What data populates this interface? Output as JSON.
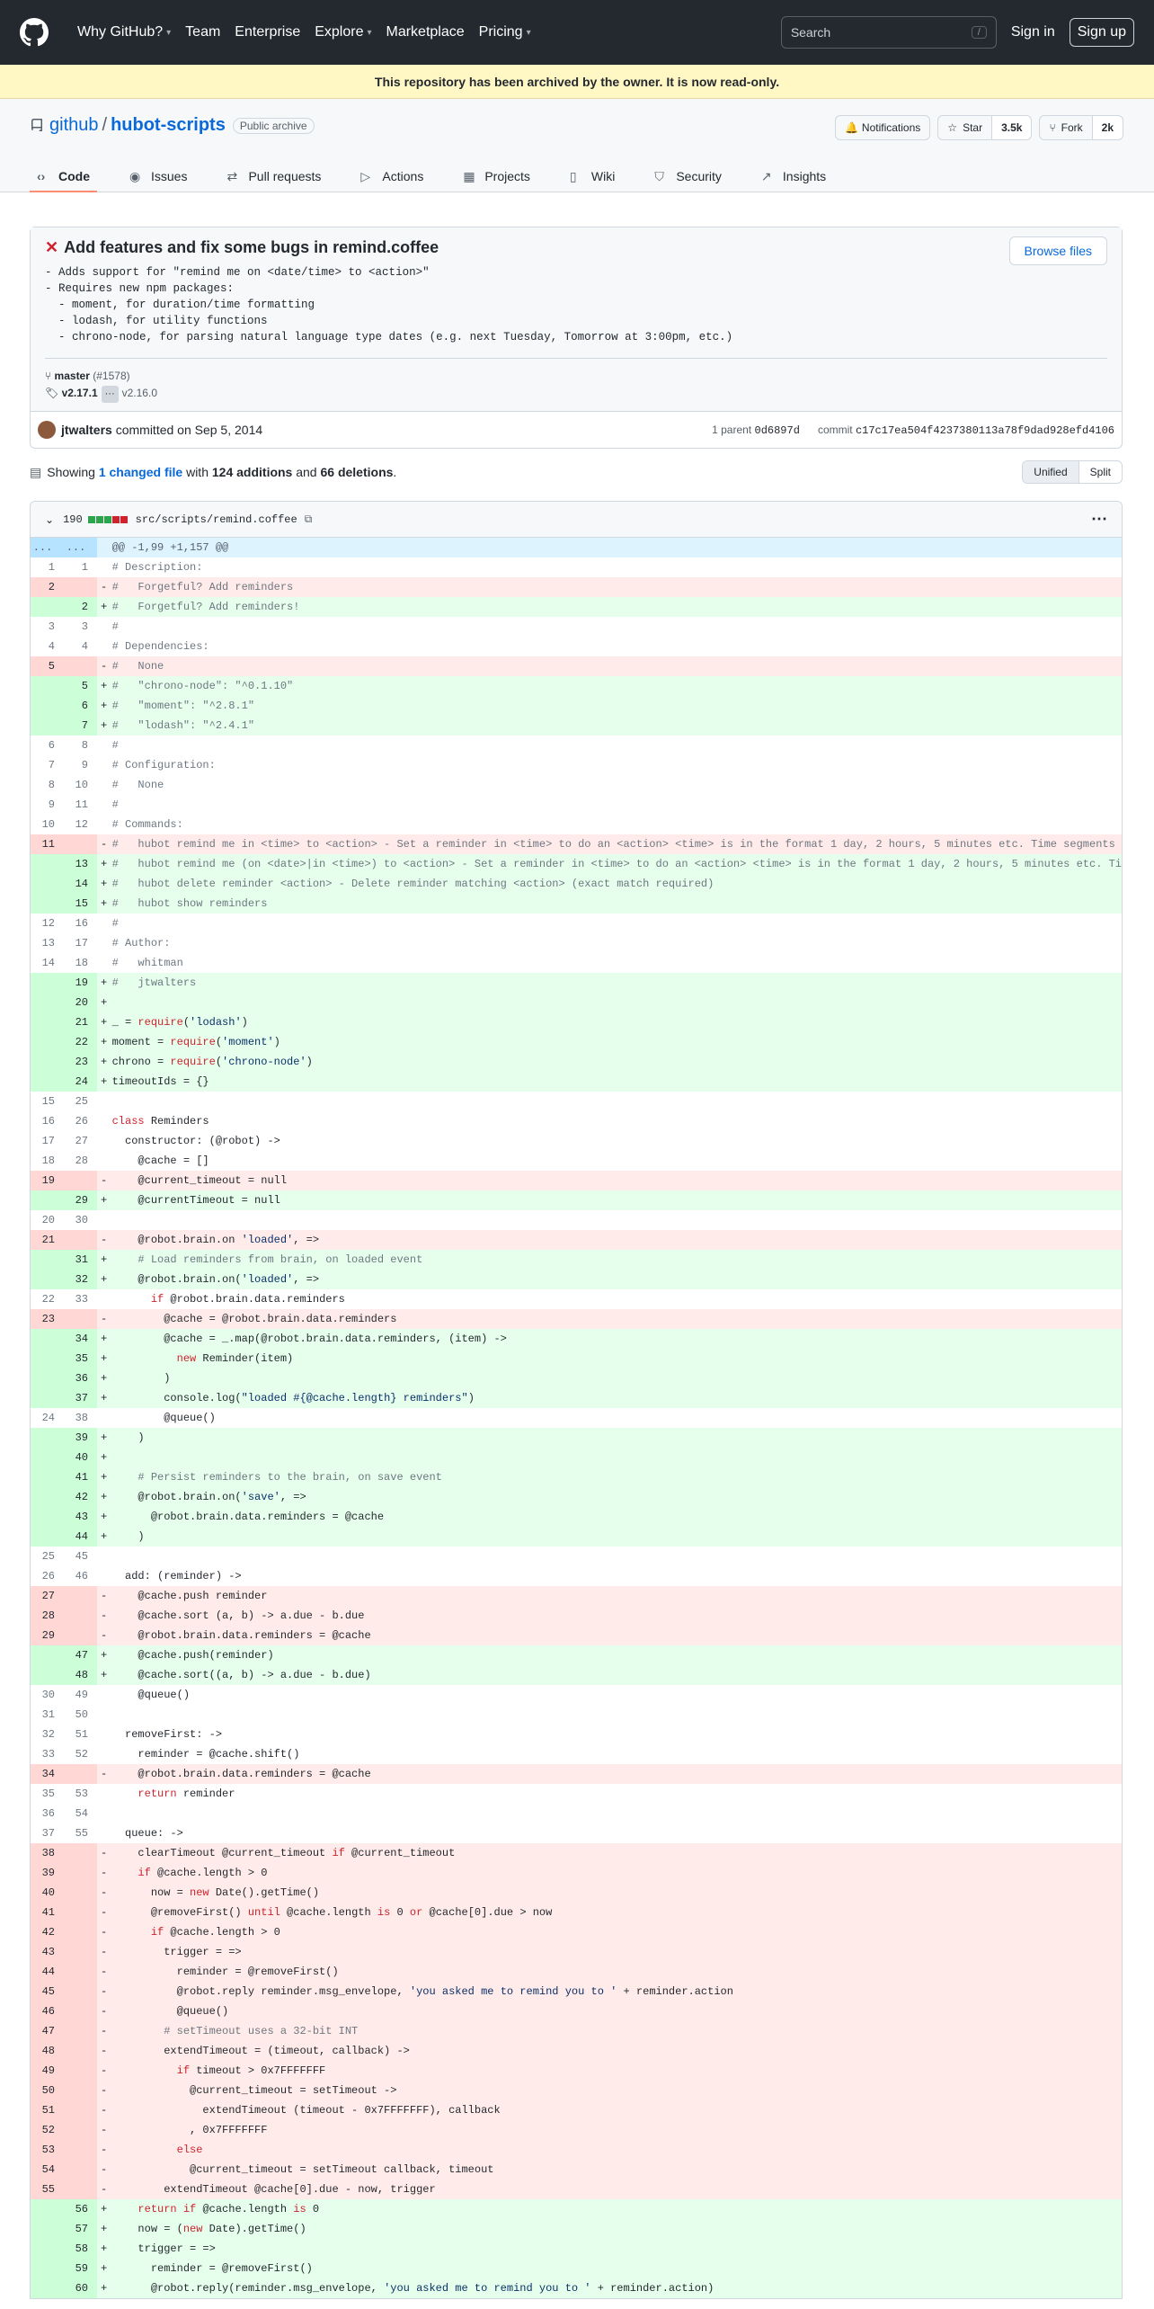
{
  "header": {
    "nav": [
      {
        "label": "Why GitHub?",
        "caret": true
      },
      {
        "label": "Team",
        "caret": false
      },
      {
        "label": "Enterprise",
        "caret": false
      },
      {
        "label": "Explore",
        "caret": true
      },
      {
        "label": "Marketplace",
        "caret": false
      },
      {
        "label": "Pricing",
        "caret": true
      }
    ],
    "search_placeholder": "Search",
    "search_key": "/",
    "signin": "Sign in",
    "signup": "Sign up"
  },
  "banner": "This repository has been archived by the owner. It is now read-only.",
  "repo": {
    "owner": "github",
    "sep": "/",
    "name": "hubot-scripts",
    "label": "Public archive",
    "notifications": "Notifications",
    "star": "Star",
    "star_count": "3.5k",
    "fork": "Fork",
    "fork_count": "2k"
  },
  "tabs": [
    {
      "label": "Code",
      "icon": "code-icon",
      "selected": true
    },
    {
      "label": "Issues",
      "icon": "issue-icon"
    },
    {
      "label": "Pull requests",
      "icon": "pull-request-icon"
    },
    {
      "label": "Actions",
      "icon": "play-icon"
    },
    {
      "label": "Projects",
      "icon": "table-icon"
    },
    {
      "label": "Wiki",
      "icon": "book-icon"
    },
    {
      "label": "Security",
      "icon": "shield-icon"
    },
    {
      "label": "Insights",
      "icon": "graph-icon"
    }
  ],
  "commit": {
    "title": "Add features and fix some bugs in remind.coffee",
    "browse": "Browse files",
    "description": "- Adds support for \"remind me on <date/time> to <action>\"\n- Requires new npm packages:\n  - moment, for duration/time formatting\n  - lodash, for utility functions\n  - chrono-node, for parsing natural language type dates (e.g. next Tuesday, Tomorrow at 3:00pm, etc.)",
    "branch": "master",
    "pr": "(#1578)",
    "tag": "v2.17.1",
    "tag_dots": "···",
    "tag_old": "v2.16.0",
    "author": "jtwalters",
    "committed": "committed on Sep 5, 2014",
    "parent_label": "1 parent",
    "parent": "0d6897d",
    "commit_label": "commit",
    "sha": "c17c17ea504f4237380113a78f9dad928efd4106"
  },
  "summary": {
    "showing": "Showing",
    "changed": "1 changed file",
    "with": "with",
    "additions": "124 additions",
    "and": "and",
    "deletions": "66 deletions",
    "end": ".",
    "unified": "Unified",
    "split": "Split"
  },
  "file": {
    "changes": "190",
    "path": "src/scripts/remind.coffee"
  },
  "diff": [
    {
      "t": "hunk",
      "l": "...",
      "r": "...",
      "c": "@@ -1,99 +1,157 @@"
    },
    {
      "t": "ctx",
      "l": "1",
      "r": "1",
      "c": "# Description:"
    },
    {
      "t": "del",
      "l": "2",
      "r": "",
      "c": "#   Forgetful? Add reminders"
    },
    {
      "t": "add",
      "l": "",
      "r": "2",
      "c": "#   Forgetful? Add reminders!"
    },
    {
      "t": "ctx",
      "l": "3",
      "r": "3",
      "c": "#"
    },
    {
      "t": "ctx",
      "l": "4",
      "r": "4",
      "c": "# Dependencies:"
    },
    {
      "t": "del",
      "l": "5",
      "r": "",
      "c": "#   None"
    },
    {
      "t": "add",
      "l": "",
      "r": "5",
      "c": "#   \"chrono-node\": \"^0.1.10\""
    },
    {
      "t": "add",
      "l": "",
      "r": "6",
      "c": "#   \"moment\": \"^2.8.1\""
    },
    {
      "t": "add",
      "l": "",
      "r": "7",
      "c": "#   \"lodash\": \"^2.4.1\""
    },
    {
      "t": "ctx",
      "l": "6",
      "r": "8",
      "c": "#"
    },
    {
      "t": "ctx",
      "l": "7",
      "r": "9",
      "c": "# Configuration:"
    },
    {
      "t": "ctx",
      "l": "8",
      "r": "10",
      "c": "#   None"
    },
    {
      "t": "ctx",
      "l": "9",
      "r": "11",
      "c": "#"
    },
    {
      "t": "ctx",
      "l": "10",
      "r": "12",
      "c": "# Commands:"
    },
    {
      "t": "del",
      "l": "11",
      "r": "",
      "c": "#   hubot remind me in <time> to <action> - Set a reminder in <time> to do an <action> <time> is in the format 1 day, 2 hours, 5 minutes etc. Time segments"
    },
    {
      "t": "add",
      "l": "",
      "r": "13",
      "c": "#   hubot remind me (on <date>|in <time>) to <action> - Set a reminder in <time> to do an <action> <time> is in the format 1 day, 2 hours, 5 minutes etc. Ti"
    },
    {
      "t": "add",
      "l": "",
      "r": "14",
      "c": "#   hubot delete reminder <action> - Delete reminder matching <action> (exact match required)"
    },
    {
      "t": "add",
      "l": "",
      "r": "15",
      "c": "#   hubot show reminders"
    },
    {
      "t": "ctx",
      "l": "12",
      "r": "16",
      "c": "#"
    },
    {
      "t": "ctx",
      "l": "13",
      "r": "17",
      "c": "# Author:"
    },
    {
      "t": "ctx",
      "l": "14",
      "r": "18",
      "c": "#   whitman"
    },
    {
      "t": "add",
      "l": "",
      "r": "19",
      "c": "#   jtwalters"
    },
    {
      "t": "add",
      "l": "",
      "r": "20",
      "c": ""
    },
    {
      "t": "add",
      "l": "",
      "r": "21",
      "c": "_ = require('lodash')"
    },
    {
      "t": "add",
      "l": "",
      "r": "22",
      "c": "moment = require('moment')"
    },
    {
      "t": "add",
      "l": "",
      "r": "23",
      "c": "chrono = require('chrono-node')"
    },
    {
      "t": "add",
      "l": "",
      "r": "24",
      "c": "timeoutIds = {}"
    },
    {
      "t": "ctx",
      "l": "15",
      "r": "25",
      "c": ""
    },
    {
      "t": "ctx",
      "l": "16",
      "r": "26",
      "c": "class Reminders"
    },
    {
      "t": "ctx",
      "l": "17",
      "r": "27",
      "c": "  constructor: (@robot) ->"
    },
    {
      "t": "ctx",
      "l": "18",
      "r": "28",
      "c": "    @cache = []"
    },
    {
      "t": "del",
      "l": "19",
      "r": "",
      "c": "    @current_timeout = null"
    },
    {
      "t": "add",
      "l": "",
      "r": "29",
      "c": "    @currentTimeout = null"
    },
    {
      "t": "ctx",
      "l": "20",
      "r": "30",
      "c": ""
    },
    {
      "t": "del",
      "l": "21",
      "r": "",
      "c": "    @robot.brain.on 'loaded', =>"
    },
    {
      "t": "add",
      "l": "",
      "r": "31",
      "c": "    # Load reminders from brain, on loaded event"
    },
    {
      "t": "add",
      "l": "",
      "r": "32",
      "c": "    @robot.brain.on('loaded', =>"
    },
    {
      "t": "ctx",
      "l": "22",
      "r": "33",
      "c": "      if @robot.brain.data.reminders"
    },
    {
      "t": "del",
      "l": "23",
      "r": "",
      "c": "        @cache = @robot.brain.data.reminders"
    },
    {
      "t": "add",
      "l": "",
      "r": "34",
      "c": "        @cache = _.map(@robot.brain.data.reminders, (item) ->"
    },
    {
      "t": "add",
      "l": "",
      "r": "35",
      "c": "          new Reminder(item)"
    },
    {
      "t": "add",
      "l": "",
      "r": "36",
      "c": "        )"
    },
    {
      "t": "add",
      "l": "",
      "r": "37",
      "c": "        console.log(\"loaded #{@cache.length} reminders\")"
    },
    {
      "t": "ctx",
      "l": "24",
      "r": "38",
      "c": "        @queue()"
    },
    {
      "t": "add",
      "l": "",
      "r": "39",
      "c": "    )"
    },
    {
      "t": "add",
      "l": "",
      "r": "40",
      "c": ""
    },
    {
      "t": "add",
      "l": "",
      "r": "41",
      "c": "    # Persist reminders to the brain, on save event"
    },
    {
      "t": "add",
      "l": "",
      "r": "42",
      "c": "    @robot.brain.on('save', =>"
    },
    {
      "t": "add",
      "l": "",
      "r": "43",
      "c": "      @robot.brain.data.reminders = @cache"
    },
    {
      "t": "add",
      "l": "",
      "r": "44",
      "c": "    )"
    },
    {
      "t": "ctx",
      "l": "25",
      "r": "45",
      "c": ""
    },
    {
      "t": "ctx",
      "l": "26",
      "r": "46",
      "c": "  add: (reminder) ->"
    },
    {
      "t": "del",
      "l": "27",
      "r": "",
      "c": "    @cache.push reminder"
    },
    {
      "t": "del",
      "l": "28",
      "r": "",
      "c": "    @cache.sort (a, b) -> a.due - b.due"
    },
    {
      "t": "del",
      "l": "29",
      "r": "",
      "c": "    @robot.brain.data.reminders = @cache"
    },
    {
      "t": "add",
      "l": "",
      "r": "47",
      "c": "    @cache.push(reminder)"
    },
    {
      "t": "add",
      "l": "",
      "r": "48",
      "c": "    @cache.sort((a, b) -> a.due - b.due)"
    },
    {
      "t": "ctx",
      "l": "30",
      "r": "49",
      "c": "    @queue()"
    },
    {
      "t": "ctx",
      "l": "31",
      "r": "50",
      "c": ""
    },
    {
      "t": "ctx",
      "l": "32",
      "r": "51",
      "c": "  removeFirst: ->"
    },
    {
      "t": "ctx",
      "l": "33",
      "r": "52",
      "c": "    reminder = @cache.shift()"
    },
    {
      "t": "del",
      "l": "34",
      "r": "",
      "c": "    @robot.brain.data.reminders = @cache"
    },
    {
      "t": "ctx",
      "l": "35",
      "r": "53",
      "c": "    return reminder"
    },
    {
      "t": "ctx",
      "l": "36",
      "r": "54",
      "c": ""
    },
    {
      "t": "ctx",
      "l": "37",
      "r": "55",
      "c": "  queue: ->"
    },
    {
      "t": "del",
      "l": "38",
      "r": "",
      "c": "    clearTimeout @current_timeout if @current_timeout"
    },
    {
      "t": "del",
      "l": "39",
      "r": "",
      "c": "    if @cache.length > 0"
    },
    {
      "t": "del",
      "l": "40",
      "r": "",
      "c": "      now = new Date().getTime()"
    },
    {
      "t": "del",
      "l": "41",
      "r": "",
      "c": "      @removeFirst() until @cache.length is 0 or @cache[0].due > now"
    },
    {
      "t": "del",
      "l": "42",
      "r": "",
      "c": "      if @cache.length > 0"
    },
    {
      "t": "del",
      "l": "43",
      "r": "",
      "c": "        trigger = =>"
    },
    {
      "t": "del",
      "l": "44",
      "r": "",
      "c": "          reminder = @removeFirst()"
    },
    {
      "t": "del",
      "l": "45",
      "r": "",
      "c": "          @robot.reply reminder.msg_envelope, 'you asked me to remind you to ' + reminder.action"
    },
    {
      "t": "del",
      "l": "46",
      "r": "",
      "c": "          @queue()"
    },
    {
      "t": "del",
      "l": "47",
      "r": "",
      "c": "        # setTimeout uses a 32-bit INT"
    },
    {
      "t": "del",
      "l": "48",
      "r": "",
      "c": "        extendTimeout = (timeout, callback) ->"
    },
    {
      "t": "del",
      "l": "49",
      "r": "",
      "c": "          if timeout > 0x7FFFFFFF"
    },
    {
      "t": "del",
      "l": "50",
      "r": "",
      "c": "            @current_timeout = setTimeout ->"
    },
    {
      "t": "del",
      "l": "51",
      "r": "",
      "c": "              extendTimeout (timeout - 0x7FFFFFFF), callback"
    },
    {
      "t": "del",
      "l": "52",
      "r": "",
      "c": "            , 0x7FFFFFFF"
    },
    {
      "t": "del",
      "l": "53",
      "r": "",
      "c": "          else"
    },
    {
      "t": "del",
      "l": "54",
      "r": "",
      "c": "            @current_timeout = setTimeout callback, timeout"
    },
    {
      "t": "del",
      "l": "55",
      "r": "",
      "c": "        extendTimeout @cache[0].due - now, trigger"
    },
    {
      "t": "add",
      "l": "",
      "r": "56",
      "c": "    return if @cache.length is 0"
    },
    {
      "t": "add",
      "l": "",
      "r": "57",
      "c": "    now = (new Date).getTime()"
    },
    {
      "t": "add",
      "l": "",
      "r": "58",
      "c": "    trigger = =>"
    },
    {
      "t": "add",
      "l": "",
      "r": "59",
      "c": "      reminder = @removeFirst()"
    },
    {
      "t": "add",
      "l": "",
      "r": "60",
      "c": "      @robot.reply(reminder.msg_envelope, 'you asked me to remind you to ' + reminder.action)"
    }
  ],
  "colors": {
    "header_bg": "#24292f",
    "banner_bg": "#fff8c5",
    "add_bg": "#e6ffec",
    "del_bg": "#ffebe9",
    "hunk_bg": "#ddf4ff",
    "link": "#0969da",
    "tab_underline": "#fd8c73"
  }
}
